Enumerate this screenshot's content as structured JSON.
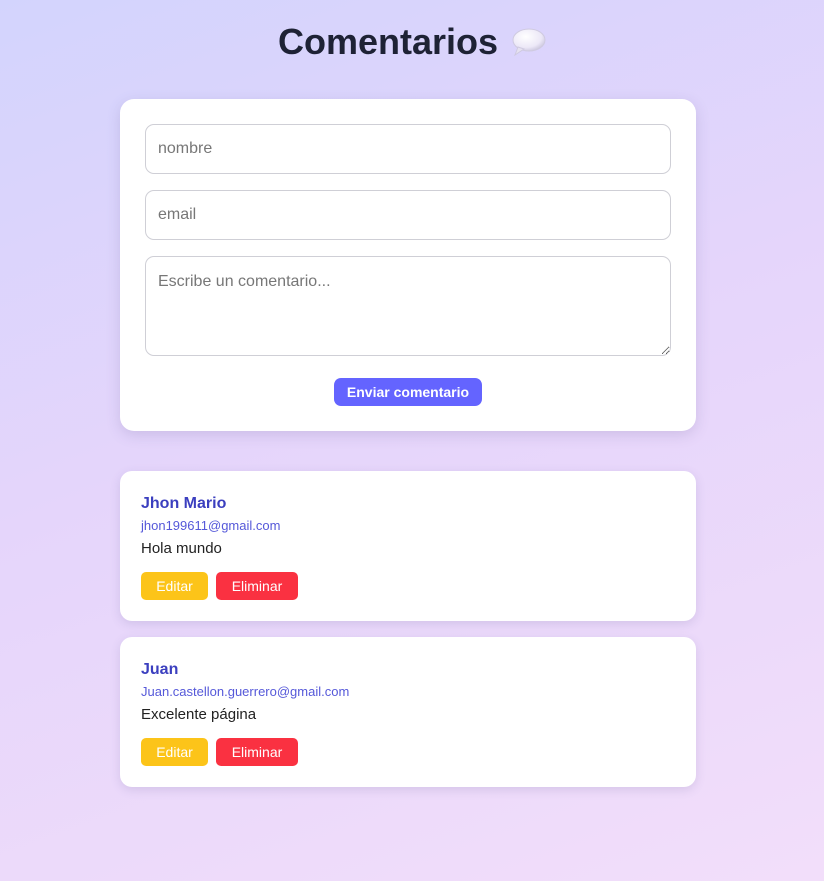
{
  "header": {
    "title": "Comentarios",
    "icon": "speech-bubble-icon"
  },
  "form": {
    "name_placeholder": "nombre",
    "email_placeholder": "email",
    "comment_placeholder": "Escribe un comentario...",
    "submit_label": "Enviar comentario"
  },
  "comments": [
    {
      "name": "Jhon Mario",
      "email": "jhon199611@gmail.com",
      "text": "Hola mundo",
      "edit_label": "Editar",
      "delete_label": "Eliminar"
    },
    {
      "name": "Juan",
      "email": "Juan.castellon.guerrero@gmail.com",
      "text": "Excelente página",
      "edit_label": "Editar",
      "delete_label": "Eliminar"
    }
  ],
  "colors": {
    "accent": "#6464ff",
    "edit": "#fcc419",
    "delete": "#fa3141",
    "name": "#3b3fbf"
  }
}
